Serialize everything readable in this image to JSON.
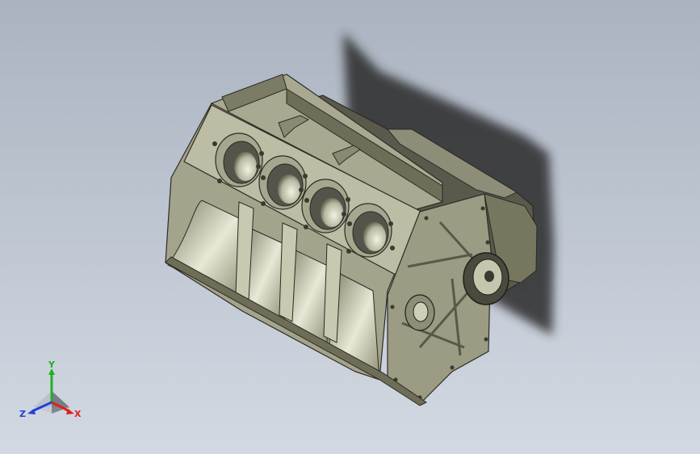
{
  "viewport": {
    "background_top": "#aab3c0",
    "background_bottom": "#d3d9e2"
  },
  "model": {
    "body_color": "#b9b8a0",
    "bore_count": 4
  },
  "triad": {
    "x_label": "X",
    "y_label": "Y",
    "z_label": "Z",
    "x_color": "#e02020",
    "y_color": "#22b022",
    "z_color": "#2040e0"
  }
}
